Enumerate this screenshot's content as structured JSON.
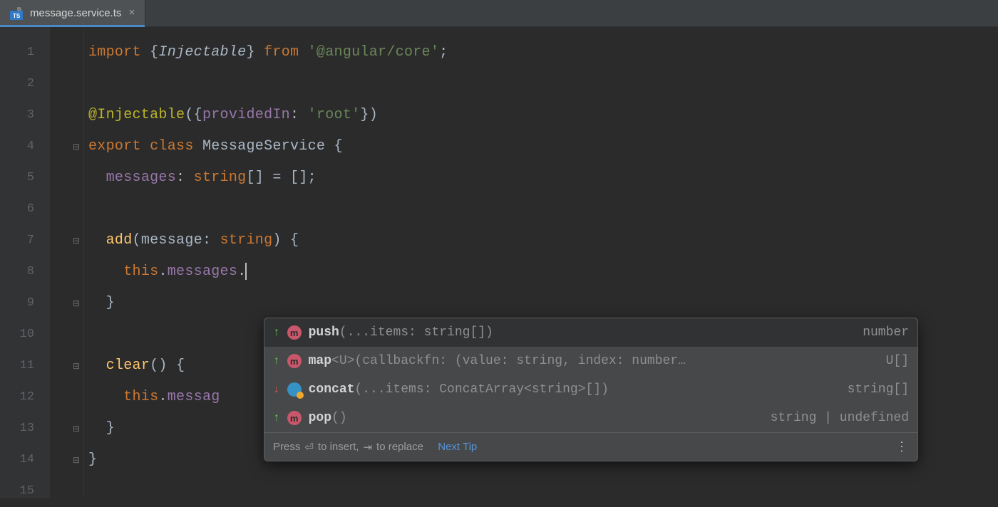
{
  "tab": {
    "title": "message.service.ts",
    "icon": "typescript-icon",
    "close_glyph": "×"
  },
  "gutter": {
    "lines": [
      "1",
      "2",
      "3",
      "4",
      "5",
      "6",
      "7",
      "8",
      "9",
      "10",
      "11",
      "12",
      "13",
      "14",
      "15"
    ]
  },
  "code": {
    "l1": {
      "kw_import": "import",
      "brace_l": "{",
      "injectable": "Injectable",
      "brace_r": "}",
      "kw_from": "from",
      "str": "'@angular/core'",
      "semi": ";"
    },
    "l3": {
      "decor": "@Injectable",
      "paren_l": "(",
      "brace_l": "{",
      "prop": "providedIn",
      "colon": ":",
      "str": "'root'",
      "brace_r": "}",
      "paren_r": ")"
    },
    "l4": {
      "kw_export": "export",
      "kw_class": "class",
      "name": "MessageService",
      "brace_l": "{"
    },
    "l5": {
      "prop": "messages",
      "colon": ":",
      "type": "string",
      "brackets": "[]",
      "eq": "=",
      "empty": "[]",
      "semi": ";"
    },
    "l7": {
      "fn": "add",
      "paren_l": "(",
      "param": "message",
      "colon": ":",
      "type": "string",
      "paren_r": ")",
      "brace_l": "{"
    },
    "l8": {
      "thiskw": "this",
      "dot1": ".",
      "prop": "messages",
      "dot2": "."
    },
    "l9": {
      "brace_r": "}"
    },
    "l11": {
      "fn": "clear",
      "parens": "()",
      "brace_l": "{"
    },
    "l12": {
      "thiskw": "this",
      "dot": ".",
      "prop_partial": "messag"
    },
    "l13": {
      "brace_r": "}"
    },
    "l14": {
      "brace_r": "}"
    }
  },
  "completion": {
    "items": [
      {
        "sort": "up",
        "kind": "m",
        "name": "push",
        "sig": "(...items: string[])",
        "ret": "number",
        "selected": true
      },
      {
        "sort": "up",
        "kind": "m",
        "name": "map",
        "sig": "<U>(callbackfn: (value: string, index: number…",
        "ret": "U[]",
        "selected": false
      },
      {
        "sort": "down",
        "kind": "o",
        "name": "concat",
        "sig": "(...items: ConcatArray<string>[])",
        "ret": "string[]",
        "selected": false
      },
      {
        "sort": "up",
        "kind": "m",
        "name": "pop",
        "sig": "()",
        "ret": "string | undefined",
        "selected": false
      }
    ],
    "footer": {
      "hint_prefix": "Press ",
      "insert_glyph": "⏎",
      "hint_mid1": " to insert, ",
      "replace_glyph": "⇥",
      "hint_mid2": " to replace",
      "next_tip": "Next Tip"
    }
  }
}
